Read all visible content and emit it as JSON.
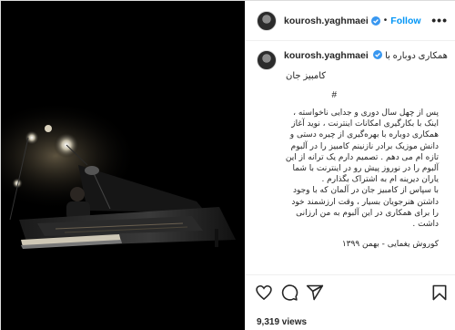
{
  "post": {
    "username": "kourosh.yaghmaei",
    "follow_label": "Follow",
    "separator": "•",
    "more_label": "•••",
    "caption_first": "همکاری دوباره با",
    "caption_second": "کامبیز جان",
    "hashtag": "#",
    "paragraph1": "پس از چهل سال دوری و جدایی ناخواسته ، اینک با بکارگیری امکانات اینترنت ، نوید آغاز همکاری دوباره با بهره‌گیری از چیره دستی و دانش موزیک برادر نازنینم کامبیز را در آلبوم تازه ام می دهم . تصمیم دارم یک ترانه از این آلبوم را در نوروز پیش رو در اینترنت با شما یاران دیرینه ام به اشتراک بگذارم .",
    "paragraph2": "با سپاس از کامبیز جان در آلمان که با وجود داشتن هنرجویان بسیار ، وقت ارزشمند خود را برای همکاری در این آلبوم به من ارزانی داشت .",
    "signature": "کوروش یغمایی - بهمن ۱۳۹۹",
    "views": "9,319 views"
  },
  "icons": {
    "like": "heart-icon",
    "comment": "comment-icon",
    "share": "share-icon",
    "save": "bookmark-icon",
    "verified": "verified-badge-icon",
    "more": "more-options-icon"
  },
  "colors": {
    "accent": "#0095f6",
    "text": "#262626",
    "photo_bg": "#000000"
  }
}
